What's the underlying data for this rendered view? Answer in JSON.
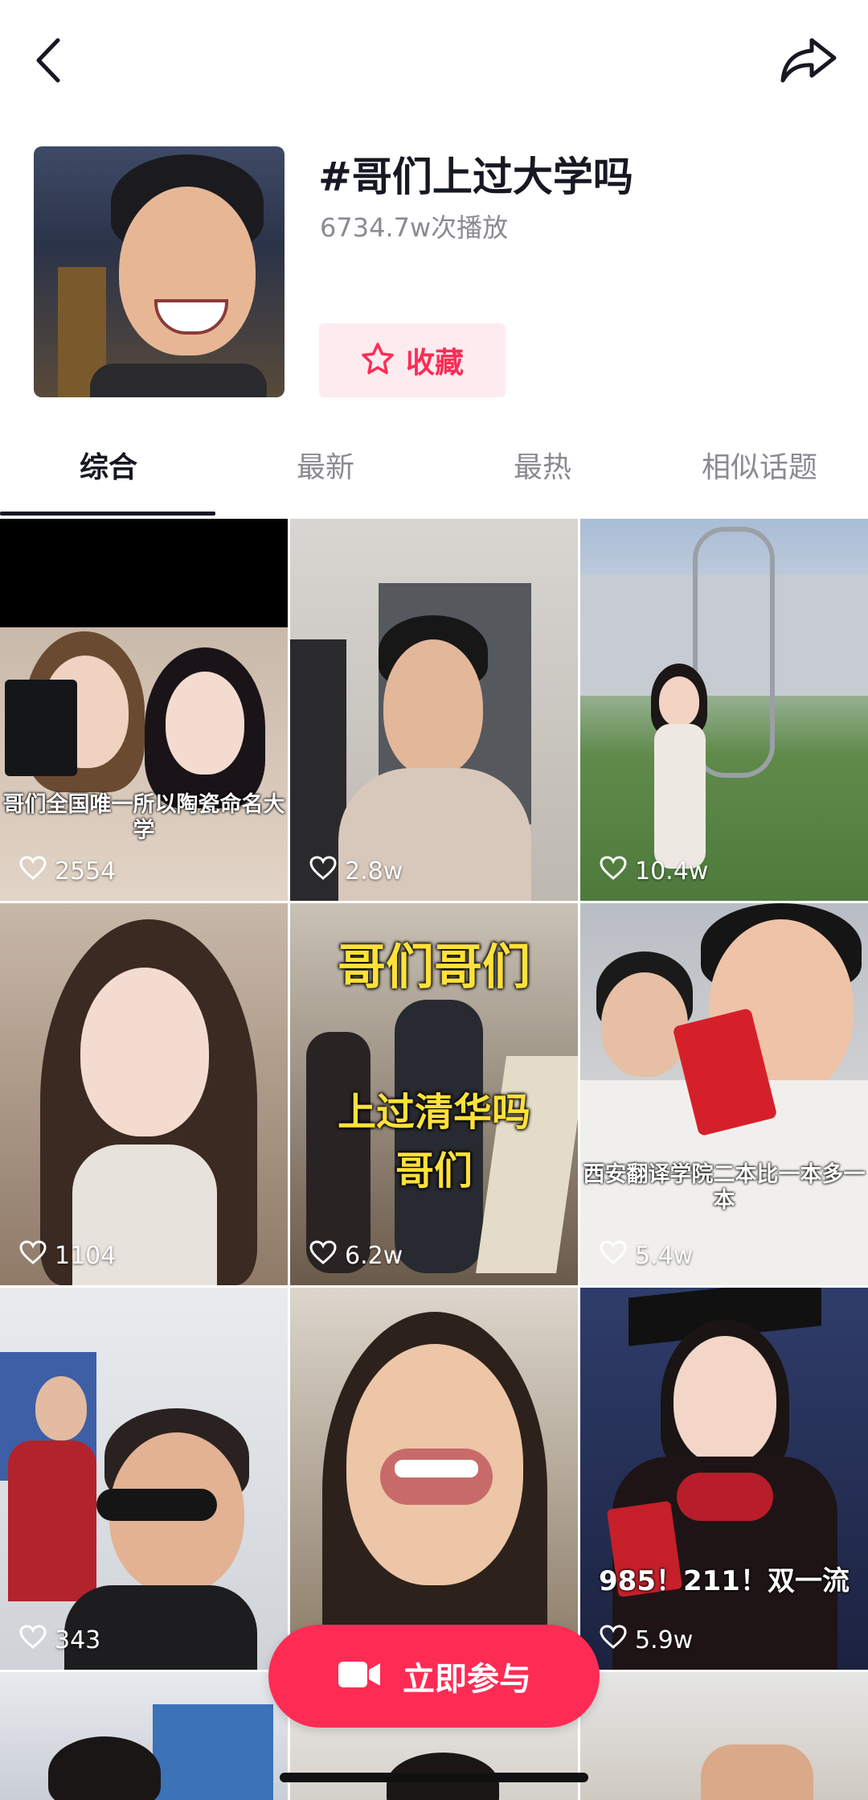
{
  "header": {
    "title": "#哥们上过大学吗",
    "play_count": "6734.7w次播放",
    "favorite_label": "收藏",
    "accent_color": "#fe2c55"
  },
  "tabs": [
    {
      "label": "综合",
      "active": true
    },
    {
      "label": "最新",
      "active": false
    },
    {
      "label": "最热",
      "active": false
    },
    {
      "label": "相似话题",
      "active": false
    }
  ],
  "videos": [
    {
      "likes": "2554",
      "caption": "哥们全国唯一所以陶瓷命名大学"
    },
    {
      "likes": "2.8w",
      "caption": ""
    },
    {
      "likes": "10.4w",
      "caption": ""
    },
    {
      "likes": "1104",
      "caption": ""
    },
    {
      "likes": "6.2w",
      "caption": "哥们哥们",
      "caption2": "上过清华吗",
      "caption3": "哥们"
    },
    {
      "likes": "5.4w",
      "caption": "西安翻译学院二本比一本多一本"
    },
    {
      "likes": "343",
      "caption": ""
    },
    {
      "likes": "",
      "caption": ""
    },
    {
      "likes": "5.9w",
      "caption": "985！211！双一流"
    }
  ],
  "join_button": {
    "label": "立即参与"
  },
  "icons": [
    "back-icon",
    "share-icon",
    "star-icon",
    "heart-icon",
    "video-camera-icon"
  ]
}
